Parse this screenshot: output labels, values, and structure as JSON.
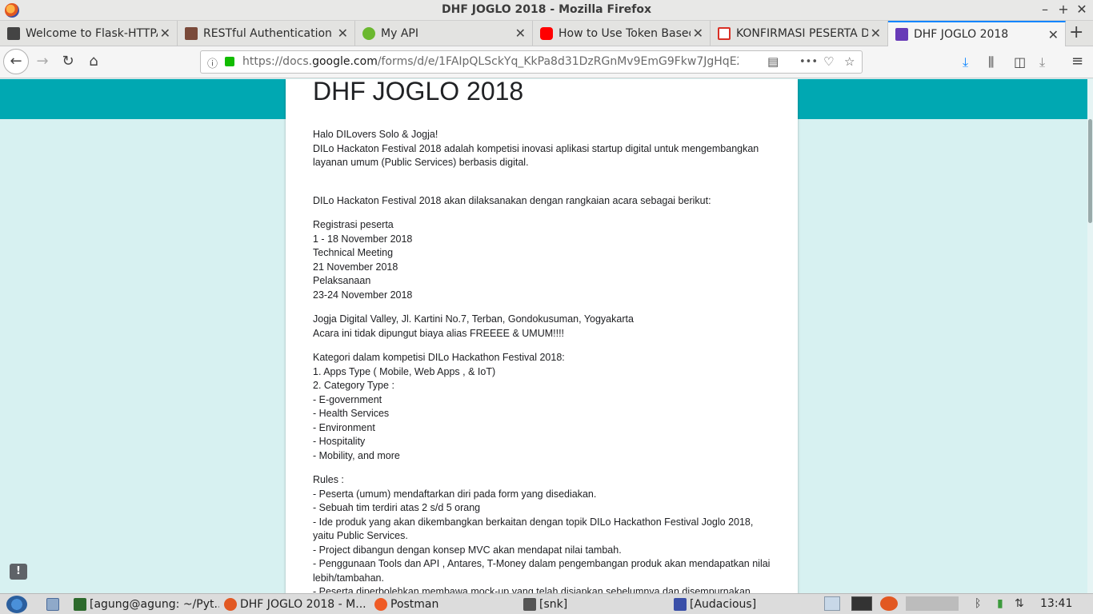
{
  "window": {
    "title": "DHF JOGLO 2018 - Mozilla Firefox",
    "minimize": "–",
    "maximize": "+",
    "close": "✕"
  },
  "tabs": [
    {
      "label": "Welcome to Flask-HTTPAuth",
      "favicon_color": "#444444",
      "close": "✕"
    },
    {
      "label": "RESTful Authentication with",
      "favicon_color": "#7a4a3a",
      "close": "✕"
    },
    {
      "label": "My API",
      "favicon_color": "#6bb82f",
      "close": "✕"
    },
    {
      "label": "How to Use Token Based",
      "favicon_color": "#ff0000",
      "close": "✕"
    },
    {
      "label": "KONFIRMASI PESERTA DHF",
      "favicon_color": "#d93025",
      "close": "✕"
    },
    {
      "label": "DHF JOGLO 2018",
      "favicon_color": "#673ab7",
      "close": "✕"
    }
  ],
  "new_tab": "+",
  "navbar": {
    "back": "←",
    "forward": "→",
    "reload": "↻",
    "home": "⌂",
    "info_icon": "ⓘ",
    "url_prefix": "https://docs.",
    "url_domain": "google.com",
    "url_rest": "/forms/d/e/1FAIpQLSckYq_KkPa8d31DzRGnMv9EmG9Fkw7JgHqE2l",
    "reader": "▤",
    "more": "•••",
    "pocket": "♡",
    "bookmark": "☆",
    "download": "⤓",
    "library": "⫼",
    "sidebar": "◫",
    "download2": "⤓",
    "menu": "≡"
  },
  "form": {
    "title": "DHF JOGLO 2018",
    "paragraphs": [
      {
        "lines": [
          "Halo DILovers Solo & Jogja!",
          "DILo Hackaton Festival 2018 adalah kompetisi inovasi aplikasi startup digital untuk mengembangkan layanan umum (Public Services) berbasis digital."
        ],
        "gap": "big"
      },
      {
        "lines": [
          "DILo Hackaton Festival 2018 akan dilaksanakan dengan rangkaian acara sebagai berikut:"
        ],
        "gap": "normal"
      },
      {
        "lines": [
          "Registrasi peserta",
          "1 - 18 November 2018",
          "Technical Meeting",
          "21 November 2018",
          "Pelaksanaan",
          "23-24 November 2018"
        ],
        "gap": "normal"
      },
      {
        "lines": [
          "Jogja Digital Valley, Jl. Kartini No.7, Terban, Gondokusuman, Yogyakarta",
          "Acara ini tidak dipungut biaya alias FREEEE & UMUM!!!!"
        ],
        "gap": "normal"
      },
      {
        "lines": [
          "Kategori dalam kompetisi DILo Hackathon Festival 2018:",
          "1. Apps Type ( Mobile, Web Apps , & IoT)",
          "2. Category Type :",
          "- E-government",
          "- Health Services",
          "- Environment",
          "- Hospitality",
          "- Mobility, and more"
        ],
        "gap": "normal"
      },
      {
        "lines": [
          "Rules :",
          "- Peserta (umum) mendaftarkan diri pada form yang disediakan.",
          "- Sebuah tim terdiri atas 2 s/d 5 orang",
          "- Ide produk yang akan dikembangkan berkaitan dengan topik DILo Hackathon Festival Joglo 2018, yaitu Public Services.",
          "- Project dibangun dengan konsep MVC akan mendapat nilai tambah.",
          "- Penggunaan Tools dan API , Antares, T-Money dalam pengembangan produk akan mendapatkan nilai lebih/tambahan.",
          "- Peserta diperbolehkan membawa mock-up yang telah disiapkan sebelumnya dan disempurnakan"
        ],
        "gap": "normal"
      }
    ],
    "feedback_icon": "!"
  },
  "taskbar": {
    "items": [
      {
        "label": "[agung@agung: ~/Pyt...",
        "icon_color": "#2d6a2d"
      },
      {
        "label": "DHF JOGLO 2018 - M...",
        "icon_color": "#e25822"
      },
      {
        "label": "Postman",
        "icon_color": "#ef5b25"
      },
      {
        "label": "[snk]",
        "icon_color": "#555555"
      },
      {
        "label": "[Audacious]",
        "icon_color": "#3a4fa8"
      }
    ],
    "tray": {
      "bluetooth": "ᛒ",
      "battery": "▮",
      "network": "⇅",
      "volume": "🔊",
      "clock": "13:41"
    }
  }
}
